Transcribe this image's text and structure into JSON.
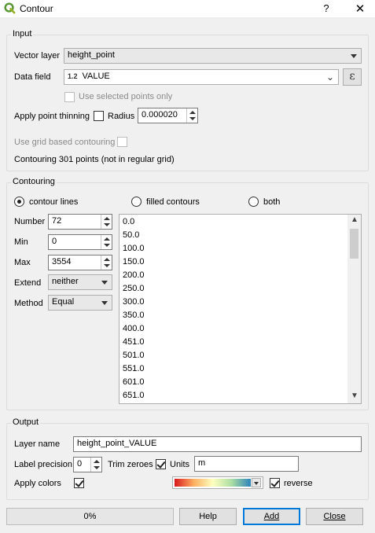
{
  "window": {
    "title": "Contour",
    "help_label": "?",
    "close_label": "✕"
  },
  "input": {
    "group_title": "Input",
    "vector_layer_label": "Vector layer",
    "vector_layer_value": "height_point",
    "data_field_label": "Data field",
    "data_field_type": "1.2",
    "data_field_value": "VALUE",
    "expression_button": "ε",
    "use_selected_label": "Use selected points only",
    "apply_thinning_label": "Apply point thinning",
    "radius_label": "Radius",
    "radius_value": "0.000020",
    "grid_contouring_label": "Use grid based contouring",
    "status_text": "Contouring 301 points (not in regular grid)"
  },
  "contouring": {
    "group_title": "Contouring",
    "radio_contour_lines": "contour lines",
    "radio_filled": "filled contours",
    "radio_both": "both",
    "number_label": "Number",
    "number_value": "72",
    "min_label": "Min",
    "min_value": "0",
    "max_label": "Max",
    "max_value": "3554",
    "extend_label": "Extend",
    "extend_value": "neither",
    "method_label": "Method",
    "method_value": "Equal",
    "levels": [
      "0.0",
      "50.0",
      "100.0",
      "150.0",
      "200.0",
      "250.0",
      "300.0",
      "350.0",
      "400.0",
      "451.0",
      "501.0",
      "551.0",
      "601.0",
      "651.0"
    ]
  },
  "output": {
    "group_title": "Output",
    "layer_name_label": "Layer name",
    "layer_name_value": "height_point_VALUE",
    "label_precision_label": "Label precision",
    "label_precision_value": "0",
    "trim_zeroes_label": "Trim zeroes",
    "units_label": "Units",
    "units_value": "m",
    "apply_colors_label": "Apply colors",
    "reverse_label": "reverse"
  },
  "footer": {
    "progress_text": "0%",
    "help_button": "Help",
    "add_button": "Add",
    "close_button": "Close"
  }
}
